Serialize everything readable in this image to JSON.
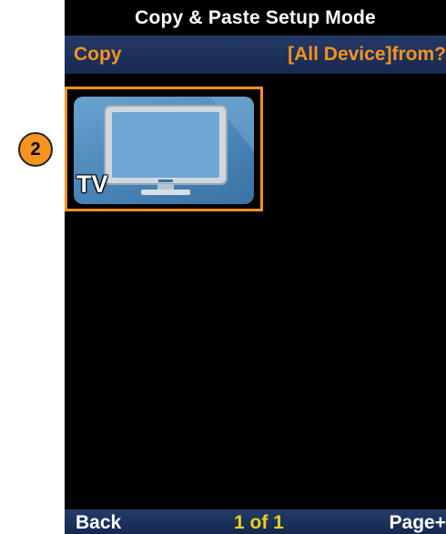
{
  "header": {
    "title": "Copy & Paste Setup Mode"
  },
  "subheader": {
    "left": "Copy",
    "right": "[All Device]from?"
  },
  "devices": [
    {
      "label": "TV",
      "icon": "tv-icon",
      "selected": true
    }
  ],
  "callout": {
    "number": "2"
  },
  "footer": {
    "back_label": "Back",
    "page_indicator": "1 of 1",
    "next_label": "Page+"
  },
  "colors": {
    "accent": "#f7931e",
    "bar_blue": "#1c3260",
    "tile_blue": "#4a86b8",
    "page_indicator": "#e8d020"
  }
}
